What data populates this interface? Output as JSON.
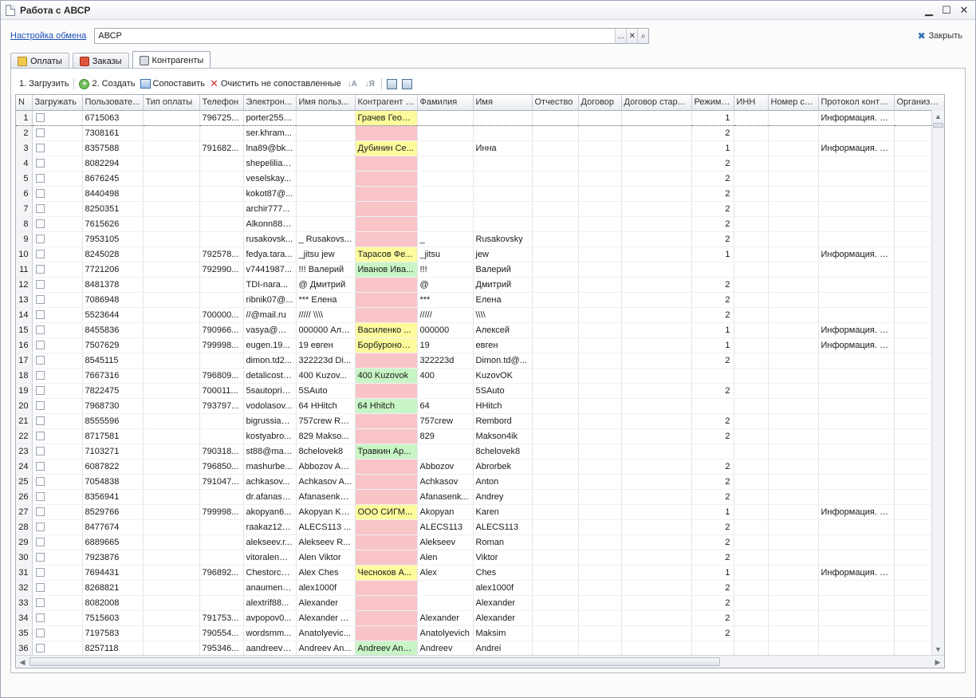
{
  "window": {
    "title": "Работа с АВСР",
    "minimize_glyph": "▁",
    "maximize_glyph": "☐",
    "close_glyph": "✕"
  },
  "exchange": {
    "link_label": "Настройка обмена",
    "field_value": "АВСР",
    "btn_select": "...",
    "btn_clear": "✕",
    "btn_open": "⌕",
    "close_label": "Закрыть"
  },
  "tabs": [
    {
      "label": "Оплаты",
      "icon": "payments-icon"
    },
    {
      "label": "Заказы",
      "icon": "orders-icon"
    },
    {
      "label": "Контрагенты",
      "icon": "counterparties-icon",
      "active": true
    }
  ],
  "toolbar": {
    "load_label": "1. Загрузить",
    "create_label": "2. Создать",
    "match_label": "Сопоставить",
    "clear_label": "Очистить не сопоставленные",
    "sort_asc": "↓A",
    "sort_desc": "↓Я"
  },
  "colors": {
    "yellow": "#fdfb9c",
    "pink": "#f8c4c8",
    "green": "#c8f5c5",
    "link": "#1b4fb5"
  },
  "columns": [
    "N",
    "Загружать",
    "Пользовате...",
    "Тип оплаты",
    "Телефон",
    "Электрон...",
    "Имя польз...",
    "Контрагент (...",
    "Фамилия",
    "Имя",
    "Отчество",
    "Договор",
    "Договор стар...",
    "Режим ...",
    "ИНН",
    "Номер сч...",
    "Протокол контр...",
    "Организац..."
  ],
  "rows": [
    {
      "n": "1",
      "user": "6715063",
      "pay": "",
      "phone": "796725...",
      "email": "porter2552...",
      "uname": "",
      "kontr": "Грачев Георг...",
      "k": "yellow",
      "fam": "",
      "name": "",
      "otch": "",
      "dog": "",
      "dogst": "",
      "mode": "1",
      "inn": "",
      "acc": "",
      "proto": "Информация. К...",
      "org": ""
    },
    {
      "n": "2",
      "user": "7308161",
      "pay": "",
      "phone": "",
      "email": "ser.khram...",
      "uname": "",
      "kontr": "",
      "k": "pink",
      "fam": "",
      "name": "",
      "otch": "",
      "dog": "",
      "dogst": "",
      "mode": "2",
      "inn": "",
      "acc": "",
      "proto": "",
      "org": ""
    },
    {
      "n": "3",
      "user": "8357588",
      "pay": "",
      "phone": "791682...",
      "email": "lna89@bk...",
      "uname": "",
      "kontr": "Дубинин Се...",
      "k": "yellow",
      "fam": "",
      "name": "Инна",
      "otch": "",
      "dog": "",
      "dogst": "",
      "mode": "1",
      "inn": "",
      "acc": "",
      "proto": "Информация. К...",
      "org": ""
    },
    {
      "n": "4",
      "user": "8082294",
      "pay": "",
      "phone": "",
      "email": "shepelilia0...",
      "uname": "",
      "kontr": "",
      "k": "pink",
      "fam": "",
      "name": "",
      "otch": "",
      "dog": "",
      "dogst": "",
      "mode": "2",
      "inn": "",
      "acc": "",
      "proto": "",
      "org": ""
    },
    {
      "n": "5",
      "user": "8676245",
      "pay": "",
      "phone": "",
      "email": "veselskay...",
      "uname": "",
      "kontr": "",
      "k": "pink",
      "fam": "",
      "name": "",
      "otch": "",
      "dog": "",
      "dogst": "",
      "mode": "2",
      "inn": "",
      "acc": "",
      "proto": "",
      "org": ""
    },
    {
      "n": "6",
      "user": "8440498",
      "pay": "",
      "phone": "",
      "email": "kokot87@...",
      "uname": "",
      "kontr": "",
      "k": "pink",
      "fam": "",
      "name": "",
      "otch": "",
      "dog": "",
      "dogst": "",
      "mode": "2",
      "inn": "",
      "acc": "",
      "proto": "",
      "org": ""
    },
    {
      "n": "7",
      "user": "8250351",
      "pay": "",
      "phone": "",
      "email": "archir777...",
      "uname": "",
      "kontr": "",
      "k": "pink",
      "fam": "",
      "name": "",
      "otch": "",
      "dog": "",
      "dogst": "",
      "mode": "2",
      "inn": "",
      "acc": "",
      "proto": "",
      "org": ""
    },
    {
      "n": "8",
      "user": "7615626",
      "pay": "",
      "phone": "",
      "email": "Alkonn888...",
      "uname": "",
      "kontr": "",
      "k": "pink",
      "fam": "",
      "name": "",
      "otch": "",
      "dog": "",
      "dogst": "",
      "mode": "2",
      "inn": "",
      "acc": "",
      "proto": "",
      "org": ""
    },
    {
      "n": "9",
      "user": "7953105",
      "pay": "",
      "phone": "",
      "email": "rusakovsk...",
      "uname": "_ Rusakovs...",
      "kontr": "",
      "k": "pink",
      "fam": "_",
      "name": "Rusakovsky",
      "otch": "",
      "dog": "",
      "dogst": "",
      "mode": "2",
      "inn": "",
      "acc": "",
      "proto": "",
      "org": ""
    },
    {
      "n": "10",
      "user": "8245028",
      "pay": "",
      "phone": "792578...",
      "email": "fedya.tara...",
      "uname": "_jitsu jew",
      "kontr": "Тарасов Фе...",
      "k": "yellow",
      "fam": "_jitsu",
      "name": "jew",
      "otch": "",
      "dog": "",
      "dogst": "",
      "mode": "1",
      "inn": "",
      "acc": "",
      "proto": "Информация. К...",
      "org": ""
    },
    {
      "n": "11",
      "user": "7721206",
      "pay": "",
      "phone": "792990...",
      "email": "v7441987...",
      "uname": "!!! Валерий",
      "kontr": "Иванов Ива...",
      "k": "green",
      "fam": "!!!",
      "name": "Валерий",
      "otch": "",
      "dog": "",
      "dogst": "",
      "mode": "",
      "inn": "",
      "acc": "",
      "proto": "",
      "org": ""
    },
    {
      "n": "12",
      "user": "8481378",
      "pay": "",
      "phone": "",
      "email": "TDI-nara...",
      "uname": "@ Дмитрий",
      "kontr": "",
      "k": "pink",
      "fam": "@",
      "name": "Дмитрий",
      "otch": "",
      "dog": "",
      "dogst": "",
      "mode": "2",
      "inn": "",
      "acc": "",
      "proto": "",
      "org": ""
    },
    {
      "n": "13",
      "user": "7086948",
      "pay": "",
      "phone": "",
      "email": "ribnik07@...",
      "uname": "*** Елена",
      "kontr": "",
      "k": "pink",
      "fam": "***",
      "name": "Елена",
      "otch": "",
      "dog": "",
      "dogst": "",
      "mode": "2",
      "inn": "",
      "acc": "",
      "proto": "",
      "org": ""
    },
    {
      "n": "14",
      "user": "5523644",
      "pay": "",
      "phone": "700000...",
      "email": "//@mail.ru",
      "uname": "///// \\\\\\\\",
      "kontr": "",
      "k": "pink",
      "fam": "/////",
      "name": "\\\\\\\\",
      "otch": "",
      "dog": "",
      "dogst": "",
      "mode": "2",
      "inn": "",
      "acc": "",
      "proto": "",
      "org": ""
    },
    {
      "n": "15",
      "user": "8455836",
      "pay": "",
      "phone": "790966...",
      "email": "vasya@ma...",
      "uname": "000000 Але...",
      "kontr": "Василенко ...",
      "k": "yellow",
      "fam": "000000",
      "name": "Алексей",
      "otch": "",
      "dog": "",
      "dogst": "",
      "mode": "1",
      "inn": "",
      "acc": "",
      "proto": "Информация. К...",
      "org": ""
    },
    {
      "n": "16",
      "user": "7507629",
      "pay": "",
      "phone": "799998...",
      "email": "eugen.19...",
      "uname": "19 евген",
      "kontr": "Борбуронов ...",
      "k": "yellow",
      "fam": "19",
      "name": "евген",
      "otch": "",
      "dog": "",
      "dogst": "",
      "mode": "1",
      "inn": "",
      "acc": "",
      "proto": "Информация. К...",
      "org": ""
    },
    {
      "n": "17",
      "user": "8545115",
      "pay": "",
      "phone": "",
      "email": "dimon.td2...",
      "uname": "322223d Di...",
      "kontr": "",
      "k": "pink",
      "fam": "322223d",
      "name": "Dimon.td@...",
      "otch": "",
      "dog": "",
      "dogst": "",
      "mode": "2",
      "inn": "",
      "acc": "",
      "proto": "",
      "org": ""
    },
    {
      "n": "18",
      "user": "7667316",
      "pay": "",
      "phone": "796809...",
      "email": "detalicost9...",
      "uname": "400 Kuzov...",
      "kontr": "400 Kuzovok",
      "k": "green",
      "fam": "400",
      "name": "KuzovOK",
      "otch": "",
      "dog": "",
      "dogst": "",
      "mode": "",
      "inn": "",
      "acc": "",
      "proto": "",
      "org": ""
    },
    {
      "n": "19",
      "user": "7822475",
      "pay": "",
      "phone": "700011...",
      "email": "5sautopric...",
      "uname": "5SAuto",
      "kontr": "",
      "k": "pink",
      "fam": "",
      "name": "5SAuto",
      "otch": "",
      "dog": "",
      "dogst": "",
      "mode": "2",
      "inn": "",
      "acc": "",
      "proto": "",
      "org": ""
    },
    {
      "n": "20",
      "user": "7968730",
      "pay": "",
      "phone": "793797...",
      "email": "vodolasov...",
      "uname": "64 HHitch",
      "kontr": "64 Hhitch",
      "k": "green",
      "fam": "64",
      "name": "HHitch",
      "otch": "",
      "dog": "",
      "dogst": "",
      "mode": "",
      "inn": "",
      "acc": "",
      "proto": "",
      "org": ""
    },
    {
      "n": "21",
      "user": "8555596",
      "pay": "",
      "phone": "",
      "email": "bigrussianr...",
      "uname": "757crew Re...",
      "kontr": "",
      "k": "pink",
      "fam": "757crew",
      "name": "Rembord",
      "otch": "",
      "dog": "",
      "dogst": "",
      "mode": "2",
      "inn": "",
      "acc": "",
      "proto": "",
      "org": ""
    },
    {
      "n": "22",
      "user": "8717581",
      "pay": "",
      "phone": "",
      "email": "kostyabro...",
      "uname": "829 Makso...",
      "kontr": "",
      "k": "pink",
      "fam": "829",
      "name": "Makson4ik",
      "otch": "",
      "dog": "",
      "dogst": "",
      "mode": "2",
      "inn": "",
      "acc": "",
      "proto": "",
      "org": ""
    },
    {
      "n": "23",
      "user": "7103271",
      "pay": "",
      "phone": "790318...",
      "email": "st88@mail...",
      "uname": "8chelovek8",
      "kontr": "Травкин Ар...",
      "k": "green",
      "fam": "",
      "name": "8chelovek8",
      "otch": "",
      "dog": "",
      "dogst": "",
      "mode": "",
      "inn": "",
      "acc": "",
      "proto": "",
      "org": ""
    },
    {
      "n": "24",
      "user": "6087822",
      "pay": "",
      "phone": "796850...",
      "email": "mashurbe...",
      "uname": "Abbozov Ab...",
      "kontr": "",
      "k": "pink",
      "fam": "Abbozov",
      "name": "Abrorbek",
      "otch": "",
      "dog": "",
      "dogst": "",
      "mode": "2",
      "inn": "",
      "acc": "",
      "proto": "",
      "org": ""
    },
    {
      "n": "25",
      "user": "7054838",
      "pay": "",
      "phone": "791047...",
      "email": "achkasov...",
      "uname": "Achkasov A...",
      "kontr": "",
      "k": "pink",
      "fam": "Achkasov",
      "name": "Anton",
      "otch": "",
      "dog": "",
      "dogst": "",
      "mode": "2",
      "inn": "",
      "acc": "",
      "proto": "",
      "org": ""
    },
    {
      "n": "26",
      "user": "8356941",
      "pay": "",
      "phone": "",
      "email": "dr.afanase...",
      "uname": "Afanasenko...",
      "kontr": "",
      "k": "pink",
      "fam": "Afanasenk...",
      "name": "Andrey",
      "otch": "",
      "dog": "",
      "dogst": "",
      "mode": "2",
      "inn": "",
      "acc": "",
      "proto": "",
      "org": ""
    },
    {
      "n": "27",
      "user": "8529766",
      "pay": "",
      "phone": "799998...",
      "email": "akopyan6...",
      "uname": "Akopyan Ka...",
      "kontr": "ООО СИГМ...",
      "k": "yellow",
      "fam": "Akopyan",
      "name": "Karen",
      "otch": "",
      "dog": "",
      "dogst": "",
      "mode": "1",
      "inn": "",
      "acc": "",
      "proto": "Информация. К...",
      "org": ""
    },
    {
      "n": "28",
      "user": "8477674",
      "pay": "",
      "phone": "",
      "email": "raakaz121...",
      "uname": "ALECS113 ...",
      "kontr": "",
      "k": "pink",
      "fam": "ALECS113",
      "name": "ALECS113",
      "otch": "",
      "dog": "",
      "dogst": "",
      "mode": "2",
      "inn": "",
      "acc": "",
      "proto": "",
      "org": ""
    },
    {
      "n": "29",
      "user": "6889665",
      "pay": "",
      "phone": "",
      "email": "alekseev.r...",
      "uname": "Alekseev R...",
      "kontr": "",
      "k": "pink",
      "fam": "Alekseev",
      "name": "Roman",
      "otch": "",
      "dog": "",
      "dogst": "",
      "mode": "2",
      "inn": "",
      "acc": "",
      "proto": "",
      "org": ""
    },
    {
      "n": "30",
      "user": "7923876",
      "pay": "",
      "phone": "",
      "email": "vitoralen@...",
      "uname": "Alen Viktor",
      "kontr": "",
      "k": "pink",
      "fam": "Alen",
      "name": "Viktor",
      "otch": "",
      "dog": "",
      "dogst": "",
      "mode": "2",
      "inn": "",
      "acc": "",
      "proto": "",
      "org": ""
    },
    {
      "n": "31",
      "user": "7694431",
      "pay": "",
      "phone": "796892...",
      "email": "Chestorch...",
      "uname": "Alex Ches",
      "kontr": "Чесноков А...",
      "k": "yellow",
      "fam": "Alex",
      "name": "Ches",
      "otch": "",
      "dog": "",
      "dogst": "",
      "mode": "1",
      "inn": "",
      "acc": "",
      "proto": "Информация. К...",
      "org": ""
    },
    {
      "n": "32",
      "user": "8268821",
      "pay": "",
      "phone": "",
      "email": "anaumenk...",
      "uname": "alex1000f",
      "kontr": "",
      "k": "pink",
      "fam": "",
      "name": "alex1000f",
      "otch": "",
      "dog": "",
      "dogst": "",
      "mode": "2",
      "inn": "",
      "acc": "",
      "proto": "",
      "org": ""
    },
    {
      "n": "33",
      "user": "8082008",
      "pay": "",
      "phone": "",
      "email": "alextrif88...",
      "uname": "Alexander",
      "kontr": "",
      "k": "pink",
      "fam": "",
      "name": "Alexander",
      "otch": "",
      "dog": "",
      "dogst": "",
      "mode": "2",
      "inn": "",
      "acc": "",
      "proto": "",
      "org": ""
    },
    {
      "n": "34",
      "user": "7515603",
      "pay": "",
      "phone": "791753...",
      "email": "avpopov0...",
      "uname": "Alexander A...",
      "kontr": "",
      "k": "pink",
      "fam": "Alexander",
      "name": "Alexander",
      "otch": "",
      "dog": "",
      "dogst": "",
      "mode": "2",
      "inn": "",
      "acc": "",
      "proto": "",
      "org": ""
    },
    {
      "n": "35",
      "user": "7197583",
      "pay": "",
      "phone": "790554...",
      "email": "wordsmm...",
      "uname": "Anatolyevic...",
      "kontr": "",
      "k": "pink",
      "fam": "Anatolyevich",
      "name": "Maksim",
      "otch": "",
      "dog": "",
      "dogst": "",
      "mode": "2",
      "inn": "",
      "acc": "",
      "proto": "",
      "org": ""
    },
    {
      "n": "36",
      "user": "8257118",
      "pay": "",
      "phone": "795346...",
      "email": "aandreev6...",
      "uname": "Andreev An...",
      "kontr": "Andreev And...",
      "k": "green",
      "fam": "Andreev",
      "name": "Andrei",
      "otch": "",
      "dog": "",
      "dogst": "",
      "mode": "",
      "inn": "",
      "acc": "",
      "proto": "",
      "org": ""
    }
  ]
}
